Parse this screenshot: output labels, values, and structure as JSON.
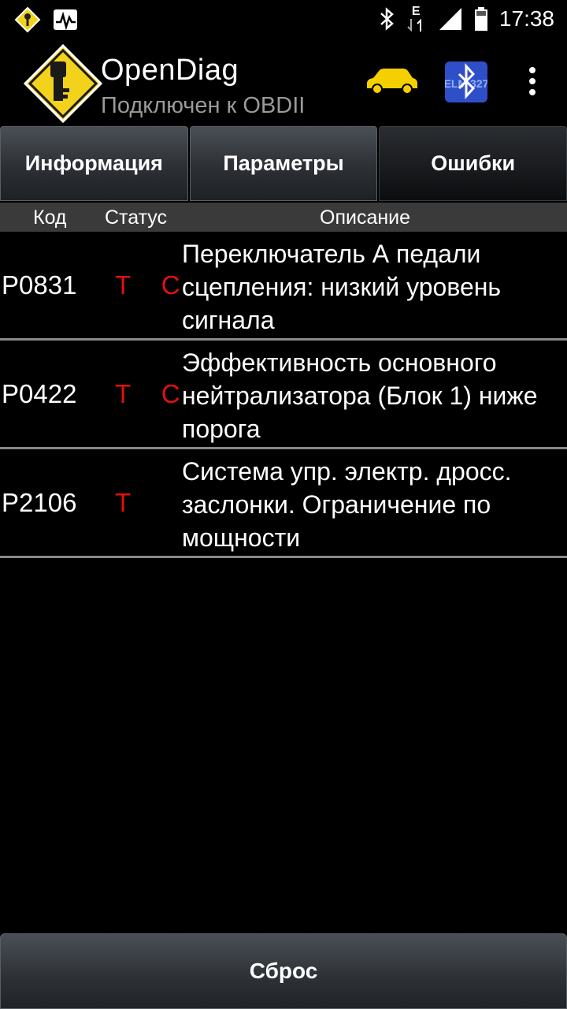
{
  "status_bar": {
    "time": "17:38",
    "left_icons": [
      "warning-key-icon",
      "activity-monitor-icon"
    ],
    "right_icons": [
      "bluetooth-icon",
      "data-e-icon",
      "signal-icon",
      "battery-icon"
    ],
    "network_label": "E"
  },
  "app_bar": {
    "title": "OpenDiag",
    "subtitle": "Подключен к OBDII",
    "logo_icon": "key-diamond-logo-icon",
    "action_icons": [
      "car-icon",
      "bluetooth-elm327-icon",
      "overflow-menu-icon"
    ],
    "elm_label": "ELM 327"
  },
  "tabs": [
    {
      "label": "Информация",
      "active": false
    },
    {
      "label": "Параметры",
      "active": false
    },
    {
      "label": "Ошибки",
      "active": true
    }
  ],
  "table": {
    "headers": {
      "code": "Код",
      "status": "Статус",
      "description": "Описание"
    },
    "rows": [
      {
        "code": "P0831",
        "status": "T C",
        "description": "Переключатель А педали сцепления: низкий уровень сигнала"
      },
      {
        "code": "P0422",
        "status": "T C",
        "description": "Эффективность основного нейтрализатора (Блок 1) ниже порога"
      },
      {
        "code": "P2106",
        "status": "T",
        "description": "Система упр. электр. дросс. заслонки. Ограничение по мощности"
      }
    ]
  },
  "reset_button": {
    "label": "Сброс"
  },
  "colors": {
    "background": "#000000",
    "status_text": "#e01010",
    "subtitle": "#9a9a9a",
    "logo_yellow": "#f2d21b",
    "car_yellow": "#f5d000",
    "bt_blue": "#2f4fc8"
  }
}
